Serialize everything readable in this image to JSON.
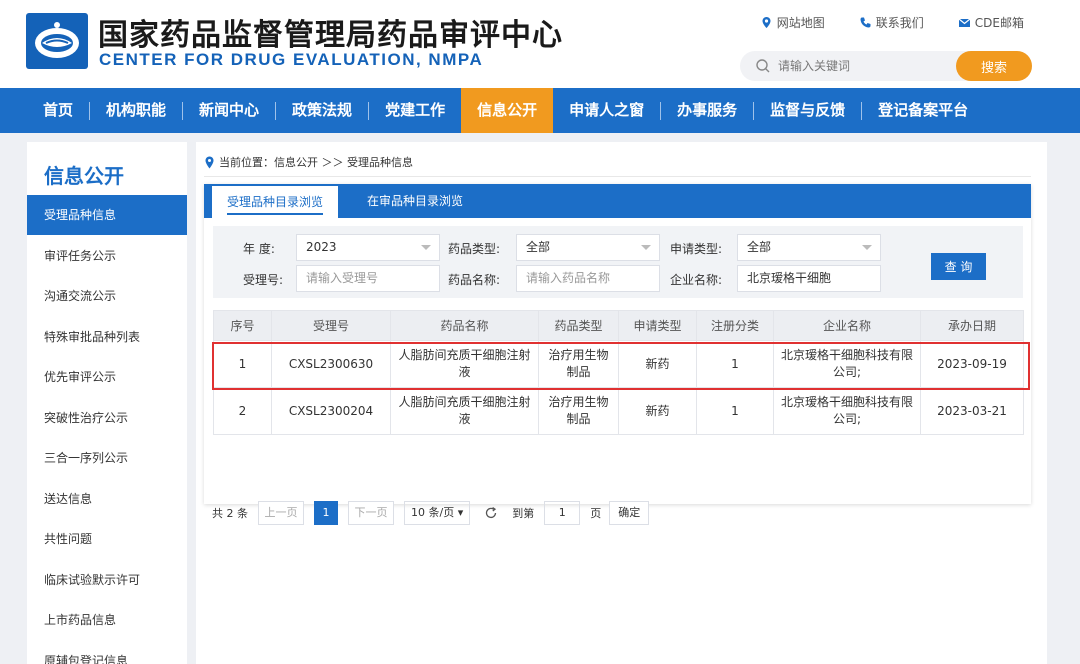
{
  "header": {
    "title": "国家药品监督管理局药品审评中心",
    "subtitle": "CENTER FOR DRUG EVALUATION, NMPA",
    "toplinks": [
      {
        "label": "网站地图",
        "icon": "location-pin-icon"
      },
      {
        "label": "联系我们",
        "icon": "phone-icon"
      },
      {
        "label": "CDE邮箱",
        "icon": "mail-icon"
      }
    ],
    "search": {
      "placeholder": "请输入关键词",
      "button": "搜索"
    }
  },
  "nav": {
    "items": [
      "首页",
      "机构职能",
      "新闻中心",
      "政策法规",
      "党建工作",
      "信息公开",
      "申请人之窗",
      "办事服务",
      "监督与反馈",
      "登记备案平台"
    ],
    "active": "信息公开"
  },
  "sidebar": {
    "title": "信息公开",
    "items": [
      "受理品种信息",
      "审评任务公示",
      "沟通交流公示",
      "特殊审批品种列表",
      "优先审评公示",
      "突破性治疗公示",
      "三合一序列公示",
      "送达信息",
      "共性问题",
      "临床试验默示许可",
      "上市药品信息",
      "原辅包登记信息"
    ],
    "active": "受理品种信息"
  },
  "breadcrumb": "当前位置：信息公开 ＞＞ 受理品种信息",
  "tabs": [
    "受理品种目录浏览",
    "在审品种目录浏览"
  ],
  "filters": {
    "year_label": "年  度:",
    "year_value": "2023",
    "drug_type_label": "药品类型:",
    "drug_type_value": "全部",
    "apply_type_label": "申请类型:",
    "apply_type_value": "全部",
    "accept_no_label": "受理号:",
    "accept_no_placeholder": "请输入受理号",
    "drug_name_label": "药品名称:",
    "drug_name_placeholder": "请输入药品名称",
    "company_label": "企业名称:",
    "company_value": "北京瑷格干细胞",
    "query_button": "查 询"
  },
  "table": {
    "columns": [
      "序号",
      "受理号",
      "药品名称",
      "药品类型",
      "申请类型",
      "注册分类",
      "企业名称",
      "承办日期"
    ],
    "rows": [
      [
        "1",
        "CXSL2300630",
        "人脂肪间充质干细胞注射液",
        "治疗用生物制品",
        "新药",
        "1",
        "北京瑷格干细胞科技有限公司;",
        "2023-09-19"
      ],
      [
        "2",
        "CXSL2300204",
        "人脂肪间充质干细胞注射液",
        "治疗用生物制品",
        "新药",
        "1",
        "北京瑷格干细胞科技有限公司;",
        "2023-03-21"
      ]
    ]
  },
  "pager": {
    "total": "共 2 条",
    "prev": "上一页",
    "current": "1",
    "next": "下一页",
    "page_size": "10 条/页",
    "goto_label": "到第",
    "goto_value": "1",
    "page_unit": "页",
    "confirm": "确定"
  },
  "colors": {
    "primary": "#1c6ec7",
    "accent": "#f19a1f",
    "highlight": "#e03131"
  }
}
